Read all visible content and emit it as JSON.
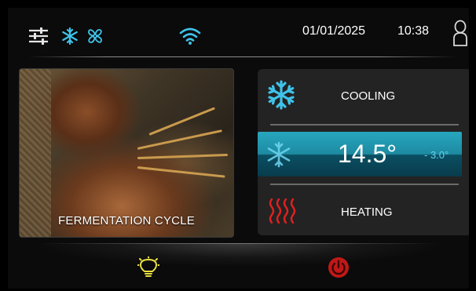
{
  "status_bar": {
    "date": "01/01/2025",
    "time": "10:38",
    "icons": [
      "settings-sliders-icon",
      "snowflake-icon",
      "fan-icon",
      "wifi-icon",
      "user-icon"
    ]
  },
  "cycle": {
    "title": "FERMENTATION CYCLE",
    "image": "bread-and-wheat-photo"
  },
  "modes": {
    "cooling_label": "COOLING",
    "heating_label": "HEATING",
    "temperature": "14.5°",
    "temperature_diff": "-  3.0°"
  },
  "bottom_bar": {
    "icons": [
      "light-bulb-icon",
      "power-icon"
    ]
  },
  "colors": {
    "accent_blue": "#27a7bf",
    "icon_blue": "#3fc3ea",
    "heating_red": "#e02020",
    "power_red": "#c01818",
    "light_yellow": "#e8e040"
  }
}
